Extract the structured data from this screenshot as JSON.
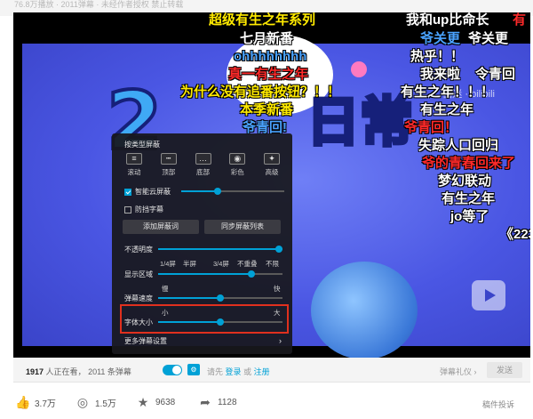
{
  "top_strip": {
    "text": "76.8万播放 · 2011弹幕 · 未经作者授权 禁止转载"
  },
  "video": {
    "watermark": "西迷 · bilibili"
  },
  "danmaku": [
    {
      "text": "超级有生之年系列",
      "color": "y"
    },
    {
      "text": "七月新番",
      "color": "w"
    },
    {
      "text": "ohhhhhhhh",
      "color": "b"
    },
    {
      "text": "真一有生之年",
      "color": "r"
    },
    {
      "text": "为什么没有追番按钮？！！",
      "color": "y"
    },
    {
      "text": "本季新番",
      "color": "y"
    },
    {
      "text": "爷青回!",
      "color": "b"
    },
    {
      "text": "我和up比命长",
      "color": "w"
    },
    {
      "text": "有",
      "color": "r"
    },
    {
      "text": "爷关更",
      "color": "b"
    },
    {
      "text": "爷关更",
      "color": "w"
    },
    {
      "text": "热乎！！",
      "color": "w"
    },
    {
      "text": "我来啦",
      "color": "w"
    },
    {
      "text": "令青回",
      "color": "w"
    },
    {
      "text": "有生之年！！！",
      "color": "w"
    },
    {
      "text": "有生之年",
      "color": "w"
    },
    {
      "text": "爷青回！",
      "color": "r"
    },
    {
      "text": "失踪人口回归",
      "color": "w"
    },
    {
      "text": "爷的青春回来了",
      "color": "r"
    },
    {
      "text": "梦幻联动",
      "color": "w"
    },
    {
      "text": "有生之年",
      "color": "w"
    },
    {
      "text": "jo等了",
      "color": "w"
    },
    {
      "text": "《223",
      "color": "w"
    }
  ],
  "settings_panel": {
    "title": "按类型屏蔽",
    "filters": [
      "滚动",
      "顶部",
      "底部",
      "彩色",
      "高级"
    ],
    "smart_block_label": "智能云屏蔽",
    "smart_block_checked": true,
    "smart_block_level": 0.35,
    "anti_cover_label": "防挡字幕",
    "anti_cover_checked": false,
    "add_block_word": "添加屏蔽词",
    "sync_block_list": "同步屏蔽列表",
    "opacity_label": "不透明度",
    "opacity_value": 1.0,
    "display_area_label": "显示区域",
    "display_area_options": [
      "1/4屏",
      "半屏",
      "3/4屏",
      "不重叠",
      "不限"
    ],
    "display_area_value": 0.75,
    "speed_label": "弹幕速度",
    "speed_slow": "慢",
    "speed_fast": "快",
    "speed_value": 0.5,
    "font_size_label": "字体大小",
    "font_size_small": "小",
    "font_size_large": "大",
    "font_size_value": 0.5,
    "more_settings": "更多弹幕设置",
    "more_arrow": "›"
  },
  "bar": {
    "viewer_count": "1917",
    "viewer_suffix": "人正在看，",
    "danmaku_count": "2011 条弹幕",
    "login_prefix": "请先",
    "login_link": "登录",
    "login_or": "或",
    "register_link": "注册",
    "etiquette": "弹幕礼仪 ›",
    "send": "发送",
    "toggle_on": true
  },
  "actions": {
    "like": "3.7万",
    "coin": "1.5万",
    "favorite": "9638",
    "share": "1128",
    "report": "稿件投诉"
  }
}
